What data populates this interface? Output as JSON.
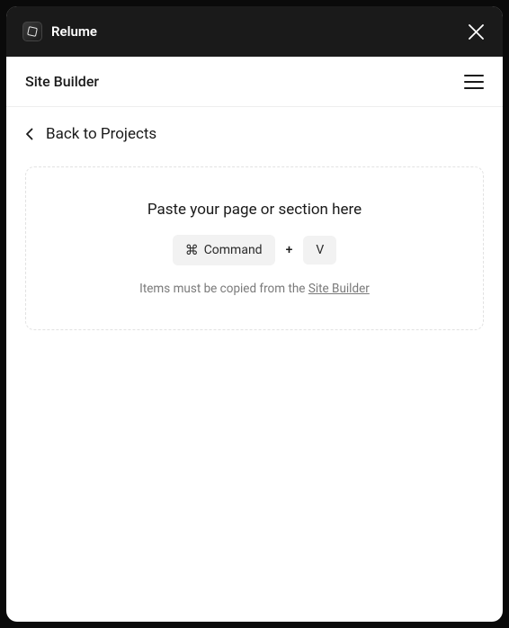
{
  "titlebar": {
    "brand": "Relume"
  },
  "subheader": {
    "title": "Site Builder"
  },
  "nav": {
    "back_label": "Back to Projects"
  },
  "paste": {
    "title": "Paste your page or section here",
    "key1_label": "Command",
    "plus": "+",
    "key2_label": "V",
    "hint_prefix": "Items must be copied from the ",
    "hint_link": "Site Builder"
  }
}
